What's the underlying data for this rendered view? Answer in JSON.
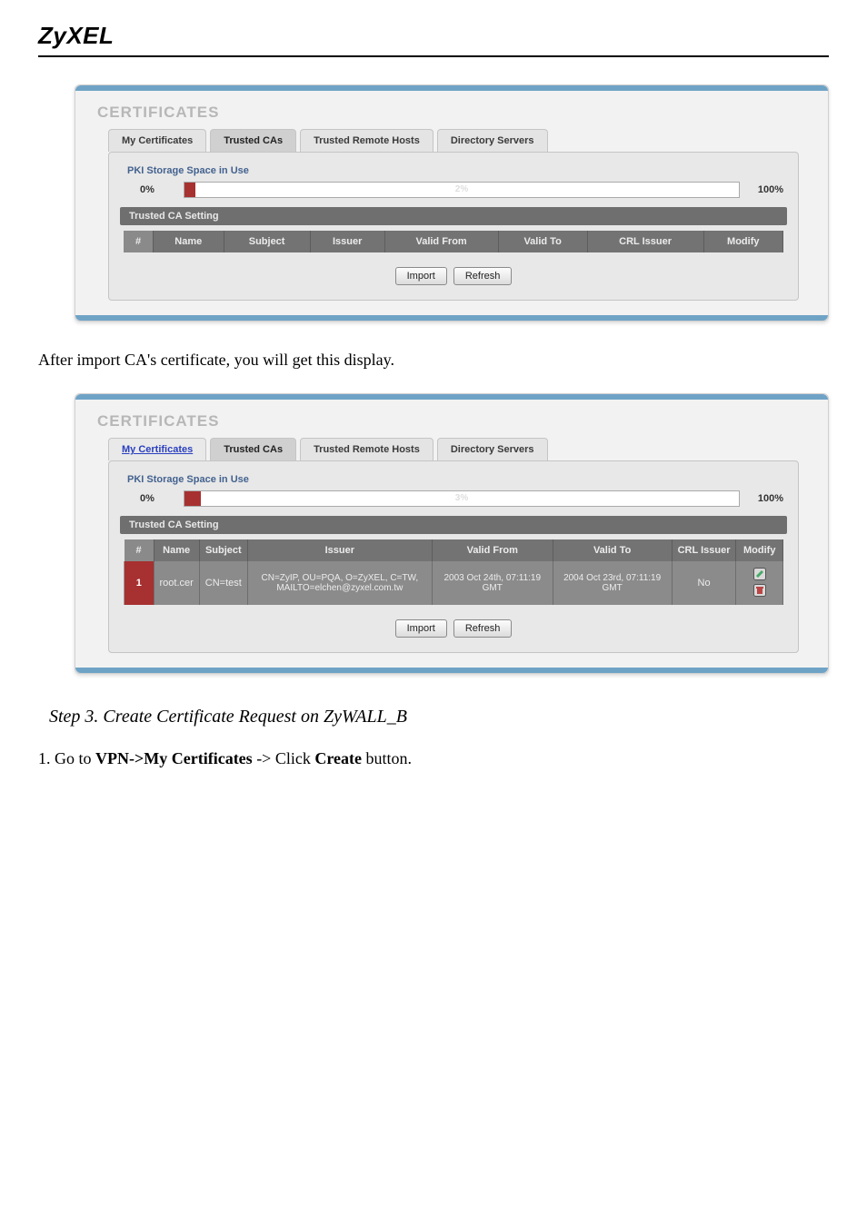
{
  "brand": "ZyXEL",
  "panel1": {
    "title": "CERTIFICATES",
    "tabs": {
      "my": "My Certificates",
      "trusted_cas": "Trusted CAs",
      "trusted_hosts": "Trusted Remote Hosts",
      "directory": "Directory Servers"
    },
    "pki_label": "PKI Storage Space in Use",
    "bar_left": "0%",
    "bar_center": "2%",
    "bar_right": "100%",
    "bar_fill_pct": 2,
    "banner": "Trusted CA Setting",
    "cols": {
      "num": "#",
      "name": "Name",
      "subject": "Subject",
      "issuer": "Issuer",
      "valid_from": "Valid From",
      "valid_to": "Valid To",
      "crl": "CRL Issuer",
      "modify": "Modify"
    },
    "buttons": {
      "import": "Import",
      "refresh": "Refresh"
    }
  },
  "para_after_import": "After import CA's certificate, you will get this display.",
  "panel2": {
    "title": "CERTIFICATES",
    "tabs": {
      "my": "My Certificates",
      "trusted_cas": "Trusted CAs",
      "trusted_hosts": "Trusted Remote Hosts",
      "directory": "Directory Servers"
    },
    "pki_label": "PKI Storage Space in Use",
    "bar_left": "0%",
    "bar_center": "3%",
    "bar_right": "100%",
    "bar_fill_pct": 3,
    "banner": "Trusted CA Setting",
    "cols": {
      "num": "#",
      "name": "Name",
      "subject": "Subject",
      "issuer": "Issuer",
      "valid_from": "Valid From",
      "valid_to": "Valid To",
      "crl": "CRL Issuer",
      "modify": "Modify"
    },
    "row": {
      "num": "1",
      "name": "root.cer",
      "subject": "CN=test",
      "issuer": "CN=ZyIP, OU=PQA, O=ZyXEL, C=TW, MAILTO=elchen@zyxel.com.tw",
      "valid_from": "2003 Oct 24th, 07:11:19 GMT",
      "valid_to": "2004 Oct 23rd, 07:11:19 GMT",
      "crl": "No"
    },
    "buttons": {
      "import": "Import",
      "refresh": "Refresh"
    }
  },
  "step_heading": "Step 3. Create Certificate Request on ZyWALL_B",
  "step_line": {
    "prefix": "1. Go to ",
    "bold1": "VPN->My Certificates",
    "mid": " -> Click ",
    "bold2": "Create",
    "suffix": " button."
  }
}
